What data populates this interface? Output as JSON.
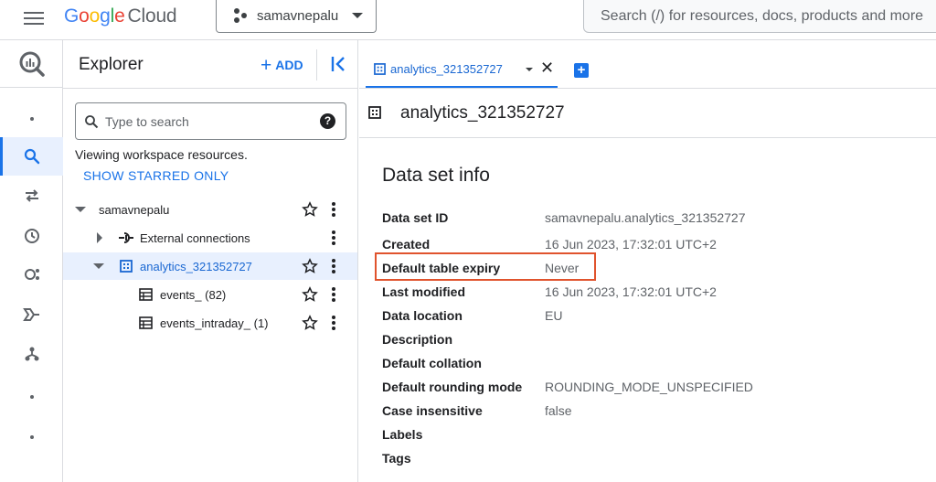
{
  "topbar": {
    "logo_google": "Google",
    "logo_cloud": "Cloud",
    "project_name": "samavnepalu",
    "search_placeholder": "Search (/) for resources, docs, products and more"
  },
  "explorer": {
    "title": "Explorer",
    "add_label": "ADD",
    "search_placeholder": "Type to search",
    "viewing_text": "Viewing workspace resources.",
    "show_starred": "SHOW STARRED ONLY",
    "tree": [
      {
        "label": "samavnepalu",
        "icon": "project-node"
      },
      {
        "label": "External connections",
        "icon": "connection-icon"
      },
      {
        "label": "analytics_321352727",
        "icon": "dataset-icon",
        "selected": true
      },
      {
        "label": "events_ (82)",
        "icon": "table-icon"
      },
      {
        "label": "events_intraday_ (1)",
        "icon": "table-icon"
      }
    ]
  },
  "tabs": [
    {
      "label": "analytics_321352727",
      "active": true
    }
  ],
  "dataset": {
    "name": "analytics_321352727",
    "section_title": "Data set info",
    "rows": [
      {
        "key": "Data set ID",
        "value": "samavnepalu.analytics_321352727"
      },
      {
        "key": "Created",
        "value": "16 Jun 2023, 17:32:01 UTC+2"
      },
      {
        "key": "Default table expiry",
        "value": "Never"
      },
      {
        "key": "Last modified",
        "value": "16 Jun 2023, 17:32:01 UTC+2"
      },
      {
        "key": "Data location",
        "value": "EU"
      },
      {
        "key": "Description",
        "value": ""
      },
      {
        "key": "Default collation",
        "value": ""
      },
      {
        "key": "Default rounding mode",
        "value": "ROUNDING_MODE_UNSPECIFIED"
      },
      {
        "key": "Case insensitive",
        "value": "false"
      },
      {
        "key": "Labels",
        "value": ""
      },
      {
        "key": "Tags",
        "value": ""
      }
    ]
  },
  "colors": {
    "accent": "#1a73e8",
    "highlight_box": "#e0532d",
    "selected_bg": "#e8f0fe"
  }
}
